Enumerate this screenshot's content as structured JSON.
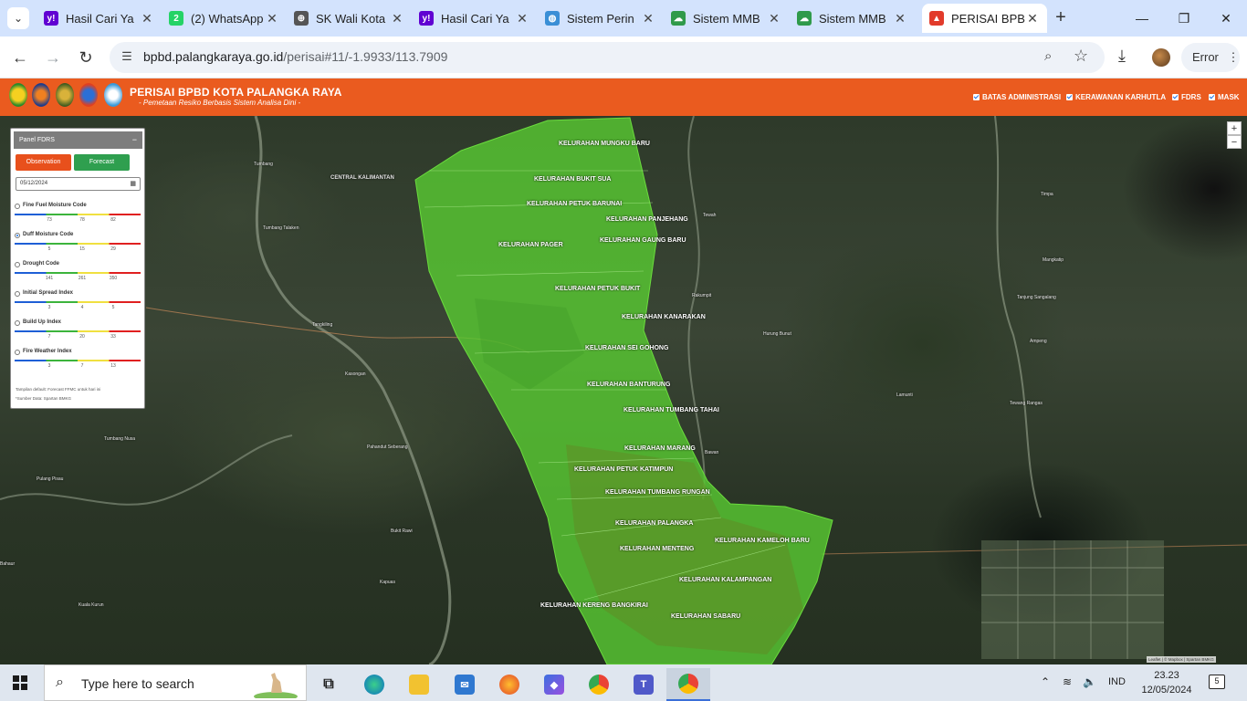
{
  "browser": {
    "tabs": [
      {
        "title": "Hasil Cari Ya",
        "icon": "yahoo-icon",
        "color": "#6001d2",
        "glyph": "y!"
      },
      {
        "title": "(2) WhatsApp",
        "icon": "whatsapp-icon",
        "color": "#25d366",
        "glyph": "2"
      },
      {
        "title": "SK Wali Kota",
        "icon": "globe-icon",
        "color": "#555555",
        "glyph": "⊕"
      },
      {
        "title": "Hasil Cari Ya",
        "icon": "yahoo-icon",
        "color": "#6001d2",
        "glyph": "y!"
      },
      {
        "title": "Sistem Perin",
        "icon": "earth-icon",
        "color": "#3a8fd6",
        "glyph": "◍"
      },
      {
        "title": "Sistem MMB",
        "icon": "cloud-icon",
        "color": "#2f9a4a",
        "glyph": "☁"
      },
      {
        "title": "Sistem MMB",
        "icon": "cloud-icon",
        "color": "#2f9a4a",
        "glyph": "☁"
      },
      {
        "title": "PERISAI BPBD",
        "icon": "bpbd-icon",
        "color": "#e23b2b",
        "glyph": "▲"
      }
    ],
    "url_host": "bpbd.palangkaraya.go.id",
    "url_path": "/perisai#11/-1.9933/113.7909",
    "profile_label": "Error"
  },
  "header": {
    "title": "PERISAI BPBD KOTA PALANGKA RAYA",
    "subtitle": "- Pemetaan Resiko Berbasis Sistem Analisa Dini -",
    "layers": [
      "BATAS ADMINISTRASI",
      "KERAWANAN KARHUTLA",
      "FDRS",
      "MASK"
    ]
  },
  "panel": {
    "title": "Panel FDRS",
    "collapse": "−",
    "btn_observation": "Observation",
    "btn_forecast": "Forecast",
    "date": "05/12/2024",
    "indices": [
      {
        "label": "Fine Fuel Moisture Code",
        "ticks": [
          "73",
          "78",
          "82"
        ],
        "selected": false
      },
      {
        "label": "Duff Moisture Code",
        "ticks": [
          "5",
          "15",
          "29"
        ],
        "selected": true
      },
      {
        "label": "Drought Code",
        "ticks": [
          "141",
          "261",
          "350"
        ],
        "selected": false
      },
      {
        "label": "Initial Spread Index",
        "ticks": [
          "3",
          "4",
          "5"
        ],
        "selected": false
      },
      {
        "label": "Build Up Index",
        "ticks": [
          "7",
          "20",
          "33"
        ],
        "selected": false
      },
      {
        "label": "Fire Weather Index",
        "ticks": [
          "3",
          "7",
          "13"
        ],
        "selected": false
      }
    ],
    "note1": "Tampilan default: Forecast FFMC untuk hari ini",
    "note2": "*Sumber Data: Spartan BMKG"
  },
  "map": {
    "kelurahan": [
      "KELURAHAN MUNGKU BARU",
      "KELURAHAN BUKIT SUA",
      "KELURAHAN PETUK BARUNAI",
      "KELURAHAN PANJEHANG",
      "KELURAHAN GAUNG BARU",
      "KELURAHAN PAGER",
      "KELURAHAN PETUK BUKIT",
      "KELURAHAN KANARAKAN",
      "KELURAHAN SEI GOHONG",
      "KELURAHAN BANTURUNG",
      "KELURAHAN TUMBANG TAHAI",
      "KELURAHAN MARANG",
      "KELURAHAN PETUK KATIMPUN",
      "KELURAHAN TUMBANG RUNGAN",
      "KELURAHAN PALANGKA",
      "KELURAHAN MENTENG",
      "KELURAHAN KAMELOH BARU",
      "KELURAHAN KALAMPANGAN",
      "KELURAHAN KERENG BANGKIRAI",
      "KELURAHAN SABARU"
    ],
    "places": [
      "CENTRAL KALIMANTAN",
      "Tumbang Talaken",
      "Tewah",
      "Rakumpit",
      "Timpa",
      "Mangkatip",
      "Hurung Bunut",
      "Tumbang",
      "Bawan",
      "Lamunti",
      "Tanjung Sangalang",
      "Ampeng",
      "Tewang Rangas",
      "Tangkiling",
      "Kasongan",
      "Tumbang Nusa",
      "Pahandut Seberang",
      "Bukit Rawi",
      "Pulang Pisau",
      "Bahaur",
      "Kapuas",
      "Kuala Kurun"
    ],
    "zoom_in": "+",
    "zoom_out": "−",
    "attribution": "Leaflet | © Mapbox | Spartan BMKG"
  },
  "taskbar": {
    "search_placeholder": "Type here to search",
    "lang": "IND",
    "time": "23.23",
    "date": "12/05/2024",
    "notifications": "5"
  },
  "colors": {
    "header_orange": "#ea5b1f",
    "fdrs_green": "#58c832",
    "observation_btn": "#e8501c",
    "forecast_btn": "#2f9f4f"
  }
}
